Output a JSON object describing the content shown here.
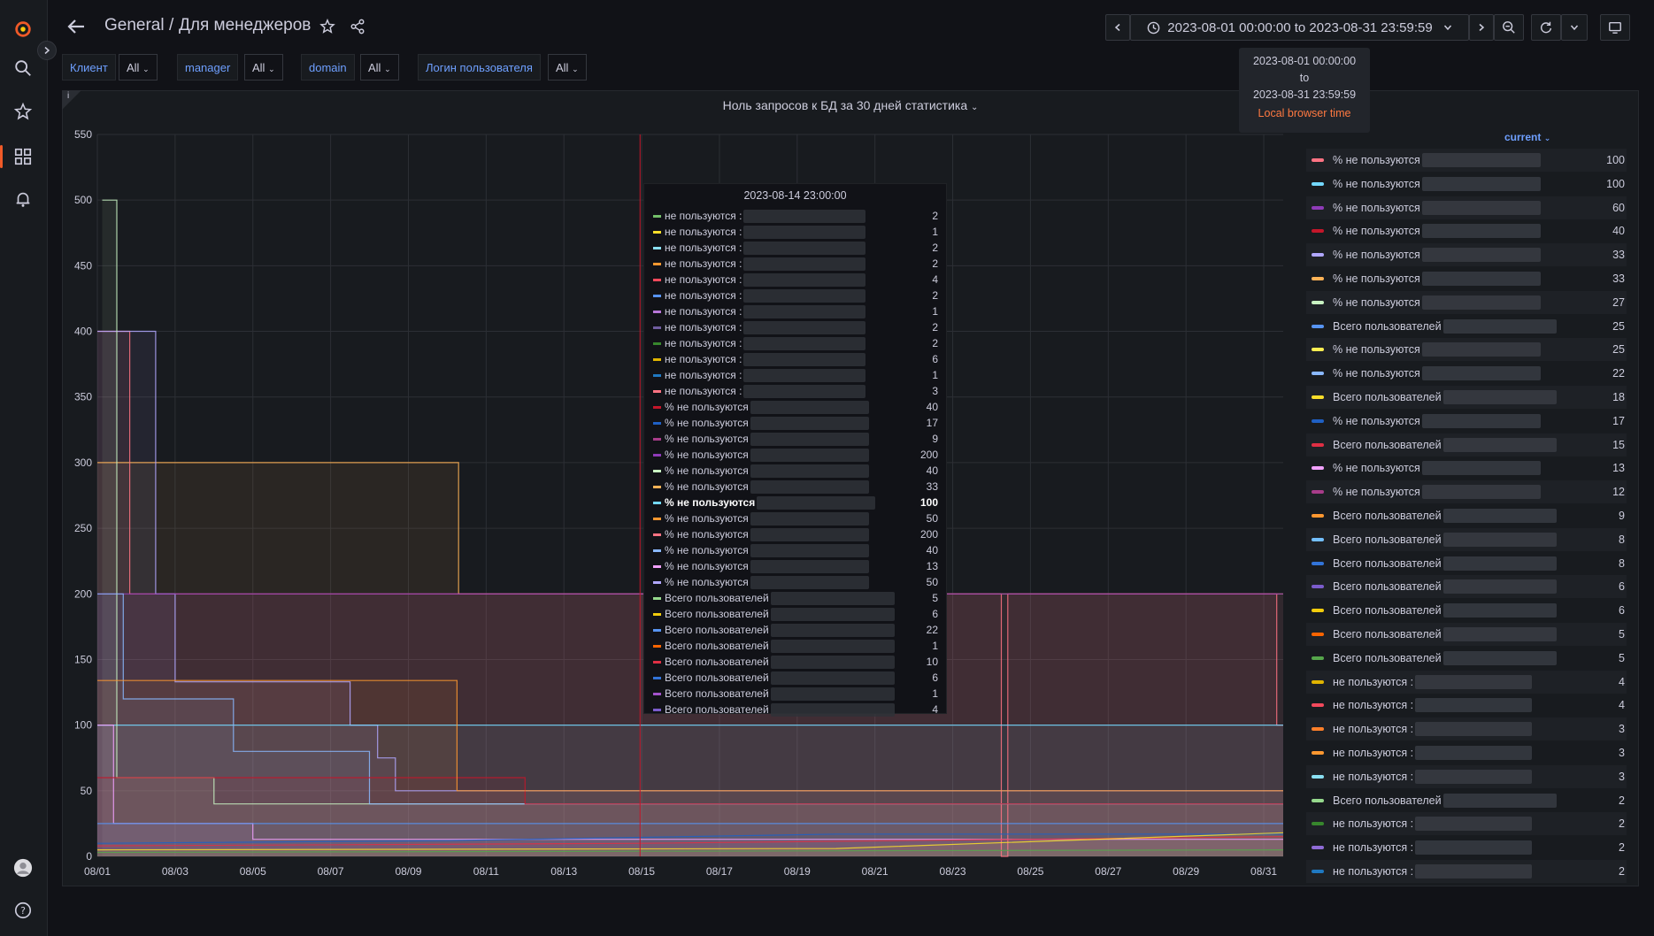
{
  "breadcrumb": {
    "folder": "General",
    "separator": "/",
    "dashboard": "Для менеджеров"
  },
  "time_range": {
    "label": "2023-08-01 00:00:00 to 2023-08-31 23:59:59"
  },
  "time_tooltip": {
    "from": "2023-08-01 00:00:00",
    "to_word": "to",
    "to": "2023-08-31 23:59:59",
    "tz": "Local browser time"
  },
  "variables": [
    {
      "label": "Клиент",
      "value": "All"
    },
    {
      "label": "manager",
      "value": "All"
    },
    {
      "label": "domain",
      "value": "All"
    },
    {
      "label": "Логин пользователя",
      "value": "All"
    }
  ],
  "panel": {
    "title": "Ноль запросов к БД за 30 дней статистика",
    "info_icon": "i"
  },
  "legend": {
    "header": "current",
    "items": [
      {
        "name": "% не пользуются",
        "value": "100",
        "color": "#ff7383"
      },
      {
        "name": "% не пользуются",
        "value": "100",
        "color": "#73d8ff"
      },
      {
        "name": "% не пользуются",
        "value": "60",
        "color": "#8f3bb8"
      },
      {
        "name": "% не пользуются",
        "value": "40",
        "color": "#c4162a"
      },
      {
        "name": "% не пользуются",
        "value": "33",
        "color": "#b1a7ff"
      },
      {
        "name": "% не пользуются",
        "value": "33",
        "color": "#ffb357"
      },
      {
        "name": "% не пользуются",
        "value": "27",
        "color": "#c8f2c2"
      },
      {
        "name": "Всего пользователей",
        "value": "25",
        "color": "#5794f2"
      },
      {
        "name": "% не пользуются",
        "value": "25",
        "color": "#ffee52"
      },
      {
        "name": "% не пользуются",
        "value": "22",
        "color": "#8ab8ff"
      },
      {
        "name": "Всего пользователей",
        "value": "18",
        "color": "#fade2a"
      },
      {
        "name": "% не пользуются",
        "value": "17",
        "color": "#1f60c4"
      },
      {
        "name": "Всего пользователей",
        "value": "15",
        "color": "#e02f44"
      },
      {
        "name": "% не пользуются",
        "value": "13",
        "color": "#f2a1ff"
      },
      {
        "name": "% не пользуются",
        "value": "12",
        "color": "#a83c8a"
      },
      {
        "name": "Всего пользователей",
        "value": "9",
        "color": "#ff9830"
      },
      {
        "name": "Всего пользователей",
        "value": "8",
        "color": "#73bfff"
      },
      {
        "name": "Всего пользователей",
        "value": "8",
        "color": "#3274d9"
      },
      {
        "name": "Всего пользователей",
        "value": "6",
        "color": "#7b5ccc"
      },
      {
        "name": "Всего пользователей",
        "value": "6",
        "color": "#f2cc0c"
      },
      {
        "name": "Всего пользователей",
        "value": "5",
        "color": "#fa6400"
      },
      {
        "name": "Всего пользователей",
        "value": "5",
        "color": "#56a64b"
      },
      {
        "name": "не пользуются :",
        "value": "4",
        "color": "#e0b400"
      },
      {
        "name": "не пользуются :",
        "value": "4",
        "color": "#f2495c"
      },
      {
        "name": "не пользуются :",
        "value": "3",
        "color": "#ff7f2a"
      },
      {
        "name": "не пользуются :",
        "value": "3",
        "color": "#ff9830"
      },
      {
        "name": "не пользуются :",
        "value": "3",
        "color": "#8ae0f2"
      },
      {
        "name": "Всего пользователей",
        "value": "2",
        "color": "#96d98d"
      },
      {
        "name": "не пользуются :",
        "value": "2",
        "color": "#37872d"
      },
      {
        "name": "не пользуются :",
        "value": "2",
        "color": "#8f6bd6"
      },
      {
        "name": "не пользуются :",
        "value": "2",
        "color": "#1f78c1"
      }
    ]
  },
  "tooltip": {
    "title": "2023-08-14 23:00:00",
    "rows": [
      {
        "name": "не пользуются :",
        "value": "2",
        "color": "#73bf69"
      },
      {
        "name": "не пользуются :",
        "value": "1",
        "color": "#fade2a"
      },
      {
        "name": "не пользуются :",
        "value": "2",
        "color": "#8ae0f2"
      },
      {
        "name": "не пользуются :",
        "value": "2",
        "color": "#ff9830"
      },
      {
        "name": "не пользуются :",
        "value": "4",
        "color": "#f2495c"
      },
      {
        "name": "не пользуются :",
        "value": "2",
        "color": "#5794f2"
      },
      {
        "name": "не пользуются :",
        "value": "1",
        "color": "#b877d9"
      },
      {
        "name": "не пользуются :",
        "value": "2",
        "color": "#705da0"
      },
      {
        "name": "не пользуются :",
        "value": "2",
        "color": "#37872d"
      },
      {
        "name": "не пользуются :",
        "value": "6",
        "color": "#e0b400"
      },
      {
        "name": "не пользуются :",
        "value": "1",
        "color": "#1f78c1"
      },
      {
        "name": "не пользуются :",
        "value": "3",
        "color": "#ff7383"
      },
      {
        "name": "% не пользуются",
        "value": "40",
        "color": "#c4162a"
      },
      {
        "name": "% не пользуются",
        "value": "17",
        "color": "#1f60c4"
      },
      {
        "name": "% не пользуются",
        "value": "9",
        "color": "#a83c8a"
      },
      {
        "name": "% не пользуются",
        "value": "200",
        "color": "#8f3bb8"
      },
      {
        "name": "% не пользуются",
        "value": "40",
        "color": "#c8f2c2"
      },
      {
        "name": "% не пользуются",
        "value": "33",
        "color": "#ffb357"
      },
      {
        "name": "% не пользуются",
        "value": "100",
        "color": "#73d8ff",
        "bold": true
      },
      {
        "name": "% не пользуются",
        "value": "50",
        "color": "#ff9830"
      },
      {
        "name": "% не пользуются",
        "value": "200",
        "color": "#ff7383"
      },
      {
        "name": "% не пользуются",
        "value": "40",
        "color": "#8ab8ff"
      },
      {
        "name": "% не пользуются",
        "value": "13",
        "color": "#f2a1ff"
      },
      {
        "name": "% не пользуются",
        "value": "50",
        "color": "#b1a7ff"
      },
      {
        "name": "Всего пользователей",
        "value": "5",
        "color": "#96d98d"
      },
      {
        "name": "Всего пользователей",
        "value": "6",
        "color": "#f2cc0c"
      },
      {
        "name": "Всего пользователей",
        "value": "22",
        "color": "#5794f2"
      },
      {
        "name": "Всего пользователей",
        "value": "1",
        "color": "#fa6400"
      },
      {
        "name": "Всего пользователей",
        "value": "10",
        "color": "#e02f44"
      },
      {
        "name": "Всего пользователей",
        "value": "6",
        "color": "#3274d9"
      },
      {
        "name": "Всего пользователей",
        "value": "1",
        "color": "#a352cc"
      },
      {
        "name": "Всего пользователей",
        "value": "4",
        "color": "#7b5ccc"
      }
    ]
  },
  "chart_data": {
    "type": "area",
    "ylim": [
      0,
      550
    ],
    "yticks": [
      0,
      50,
      100,
      150,
      200,
      250,
      300,
      350,
      400,
      450,
      500,
      550
    ],
    "xlim": [
      "2023-08-01",
      "2023-08-31T12:00"
    ],
    "xticks": [
      "08/01",
      "08/03",
      "08/05",
      "08/07",
      "08/09",
      "08/11",
      "08/13",
      "08/15",
      "08/17",
      "08/19",
      "08/21",
      "08/23",
      "08/25",
      "08/27",
      "08/29",
      "08/31"
    ],
    "xtick_dates": [
      "2023-08-01",
      "2023-08-03",
      "2023-08-05",
      "2023-08-07",
      "2023-08-09",
      "2023-08-11",
      "2023-08-13",
      "2023-08-15",
      "2023-08-17",
      "2023-08-19",
      "2023-08-21",
      "2023-08-23",
      "2023-08-25",
      "2023-08-27",
      "2023-08-29",
      "2023-08-31"
    ],
    "cursor_date": "2023-08-14T23:00",
    "series": [
      {
        "color": "#ffb357",
        "points": [
          [
            "2023-08-01",
            300
          ],
          [
            "2023-08-10T07:00",
            300
          ],
          [
            "2023-08-10T07:00",
            200
          ],
          [
            "2023-08-31T12:00",
            200
          ]
        ]
      },
      {
        "color": "#ff7383",
        "points": [
          [
            "2023-08-01",
            400
          ],
          [
            "2023-08-01T20:00",
            400
          ],
          [
            "2023-08-01T20:00",
            200
          ],
          [
            "2023-08-24T06:00",
            200
          ],
          [
            "2023-08-24T06:00",
            0
          ],
          [
            "2023-08-24T10:00",
            0
          ],
          [
            "2023-08-24T10:00",
            200
          ],
          [
            "2023-08-31T08:00",
            200
          ],
          [
            "2023-08-31T08:00",
            100
          ],
          [
            "2023-08-31T12:00",
            100
          ]
        ]
      },
      {
        "color": "#b1a7ff",
        "points": [
          [
            "2023-08-01",
            400
          ],
          [
            "2023-08-02T12:00",
            400
          ],
          [
            "2023-08-02T12:00",
            200
          ],
          [
            "2023-08-03",
            200
          ],
          [
            "2023-08-03",
            133
          ],
          [
            "2023-08-07T12:00",
            133
          ],
          [
            "2023-08-07T12:00",
            100
          ],
          [
            "2023-08-08T05:00",
            100
          ],
          [
            "2023-08-08T05:00",
            75
          ],
          [
            "2023-08-08T16:00",
            75
          ],
          [
            "2023-08-08T16:00",
            50
          ],
          [
            "2023-08-31T12:00",
            50
          ]
        ]
      },
      {
        "color": "#8f3bb8",
        "points": [
          [
            "2023-08-01",
            200
          ],
          [
            "2023-08-31T12:00",
            200
          ]
        ]
      },
      {
        "color": "#73d8ff",
        "points": [
          [
            "2023-08-01",
            100
          ],
          [
            "2023-08-31T12:00",
            100
          ]
        ]
      },
      {
        "color": "#c8f2c2",
        "points": [
          [
            "2023-08-01T03:00",
            500
          ],
          [
            "2023-08-01T12:00",
            500
          ],
          [
            "2023-08-01T12:00",
            60
          ],
          [
            "2023-08-04",
            60
          ],
          [
            "2023-08-04",
            40
          ],
          [
            "2023-08-31T12:00",
            40
          ]
        ]
      },
      {
        "color": "#f2a1ff",
        "points": [
          [
            "2023-08-01",
            100
          ],
          [
            "2023-08-01T10:00",
            100
          ],
          [
            "2023-08-01T10:00",
            25
          ],
          [
            "2023-08-05",
            25
          ],
          [
            "2023-08-05",
            13
          ],
          [
            "2023-08-31T12:00",
            13
          ]
        ]
      },
      {
        "color": "#8ab8ff",
        "points": [
          [
            "2023-08-01",
            200
          ],
          [
            "2023-08-01T16:00",
            200
          ],
          [
            "2023-08-01T16:00",
            120
          ],
          [
            "2023-08-04T12:00",
            120
          ],
          [
            "2023-08-04T12:00",
            80
          ],
          [
            "2023-08-08",
            80
          ],
          [
            "2023-08-08",
            40
          ],
          [
            "2023-08-31T12:00",
            40
          ]
        ]
      },
      {
        "color": "#c4162a",
        "points": [
          [
            "2023-08-01",
            60
          ],
          [
            "2023-08-12",
            60
          ],
          [
            "2023-08-12",
            40
          ],
          [
            "2023-08-31T12:00",
            40
          ]
        ]
      },
      {
        "color": "#ff9830",
        "points": [
          [
            "2023-08-01",
            134
          ],
          [
            "2023-08-10T06:00",
            134
          ],
          [
            "2023-08-10T06:00",
            50
          ],
          [
            "2023-08-31T12:00",
            50
          ]
        ]
      },
      {
        "color": "#5794f2",
        "points": [
          [
            "2023-08-01",
            25
          ],
          [
            "2023-08-31T12:00",
            25
          ]
        ]
      },
      {
        "color": "#1f60c4",
        "points": [
          [
            "2023-08-01",
            10
          ],
          [
            "2023-08-10",
            12
          ],
          [
            "2023-08-20",
            17
          ],
          [
            "2023-08-31T12:00",
            17
          ]
        ]
      },
      {
        "color": "#e02f44",
        "points": [
          [
            "2023-08-01",
            8
          ],
          [
            "2023-08-15",
            10
          ],
          [
            "2023-08-31T12:00",
            15
          ]
        ]
      },
      {
        "color": "#fade2a",
        "points": [
          [
            "2023-08-01",
            5
          ],
          [
            "2023-08-20",
            6
          ],
          [
            "2023-08-31T12:00",
            18
          ]
        ]
      },
      {
        "color": "#56a64b",
        "points": [
          [
            "2023-08-01",
            3
          ],
          [
            "2023-08-31T12:00",
            5
          ]
        ]
      }
    ]
  }
}
